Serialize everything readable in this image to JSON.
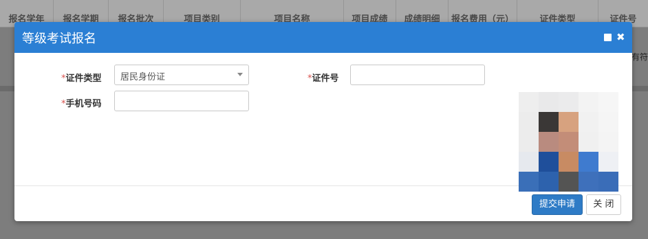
{
  "background": {
    "columns": [
      "报名学年",
      "报名学期",
      "报名批次",
      "项目类别",
      "项目名称",
      "项目成绩",
      "成绩明细",
      "报名费用（元）",
      "证件类型",
      "证件号"
    ],
    "right_text": "有符"
  },
  "modal": {
    "title": "等级考试报名",
    "fields": {
      "id_type_label": "证件类型",
      "id_type_value": "居民身份证",
      "id_number_label": "证件号",
      "id_number_value": "",
      "phone_label": "手机号码",
      "phone_value": "",
      "required_mark": "*"
    },
    "buttons": {
      "submit": "提交申请",
      "close": "关 闭"
    }
  },
  "colors": {
    "header": "#2b7fd4",
    "primary_button": "#2e7bc6",
    "required": "#d9534f"
  },
  "icons": [
    "maximize-icon",
    "close-icon",
    "dropdown-caret-icon"
  ]
}
